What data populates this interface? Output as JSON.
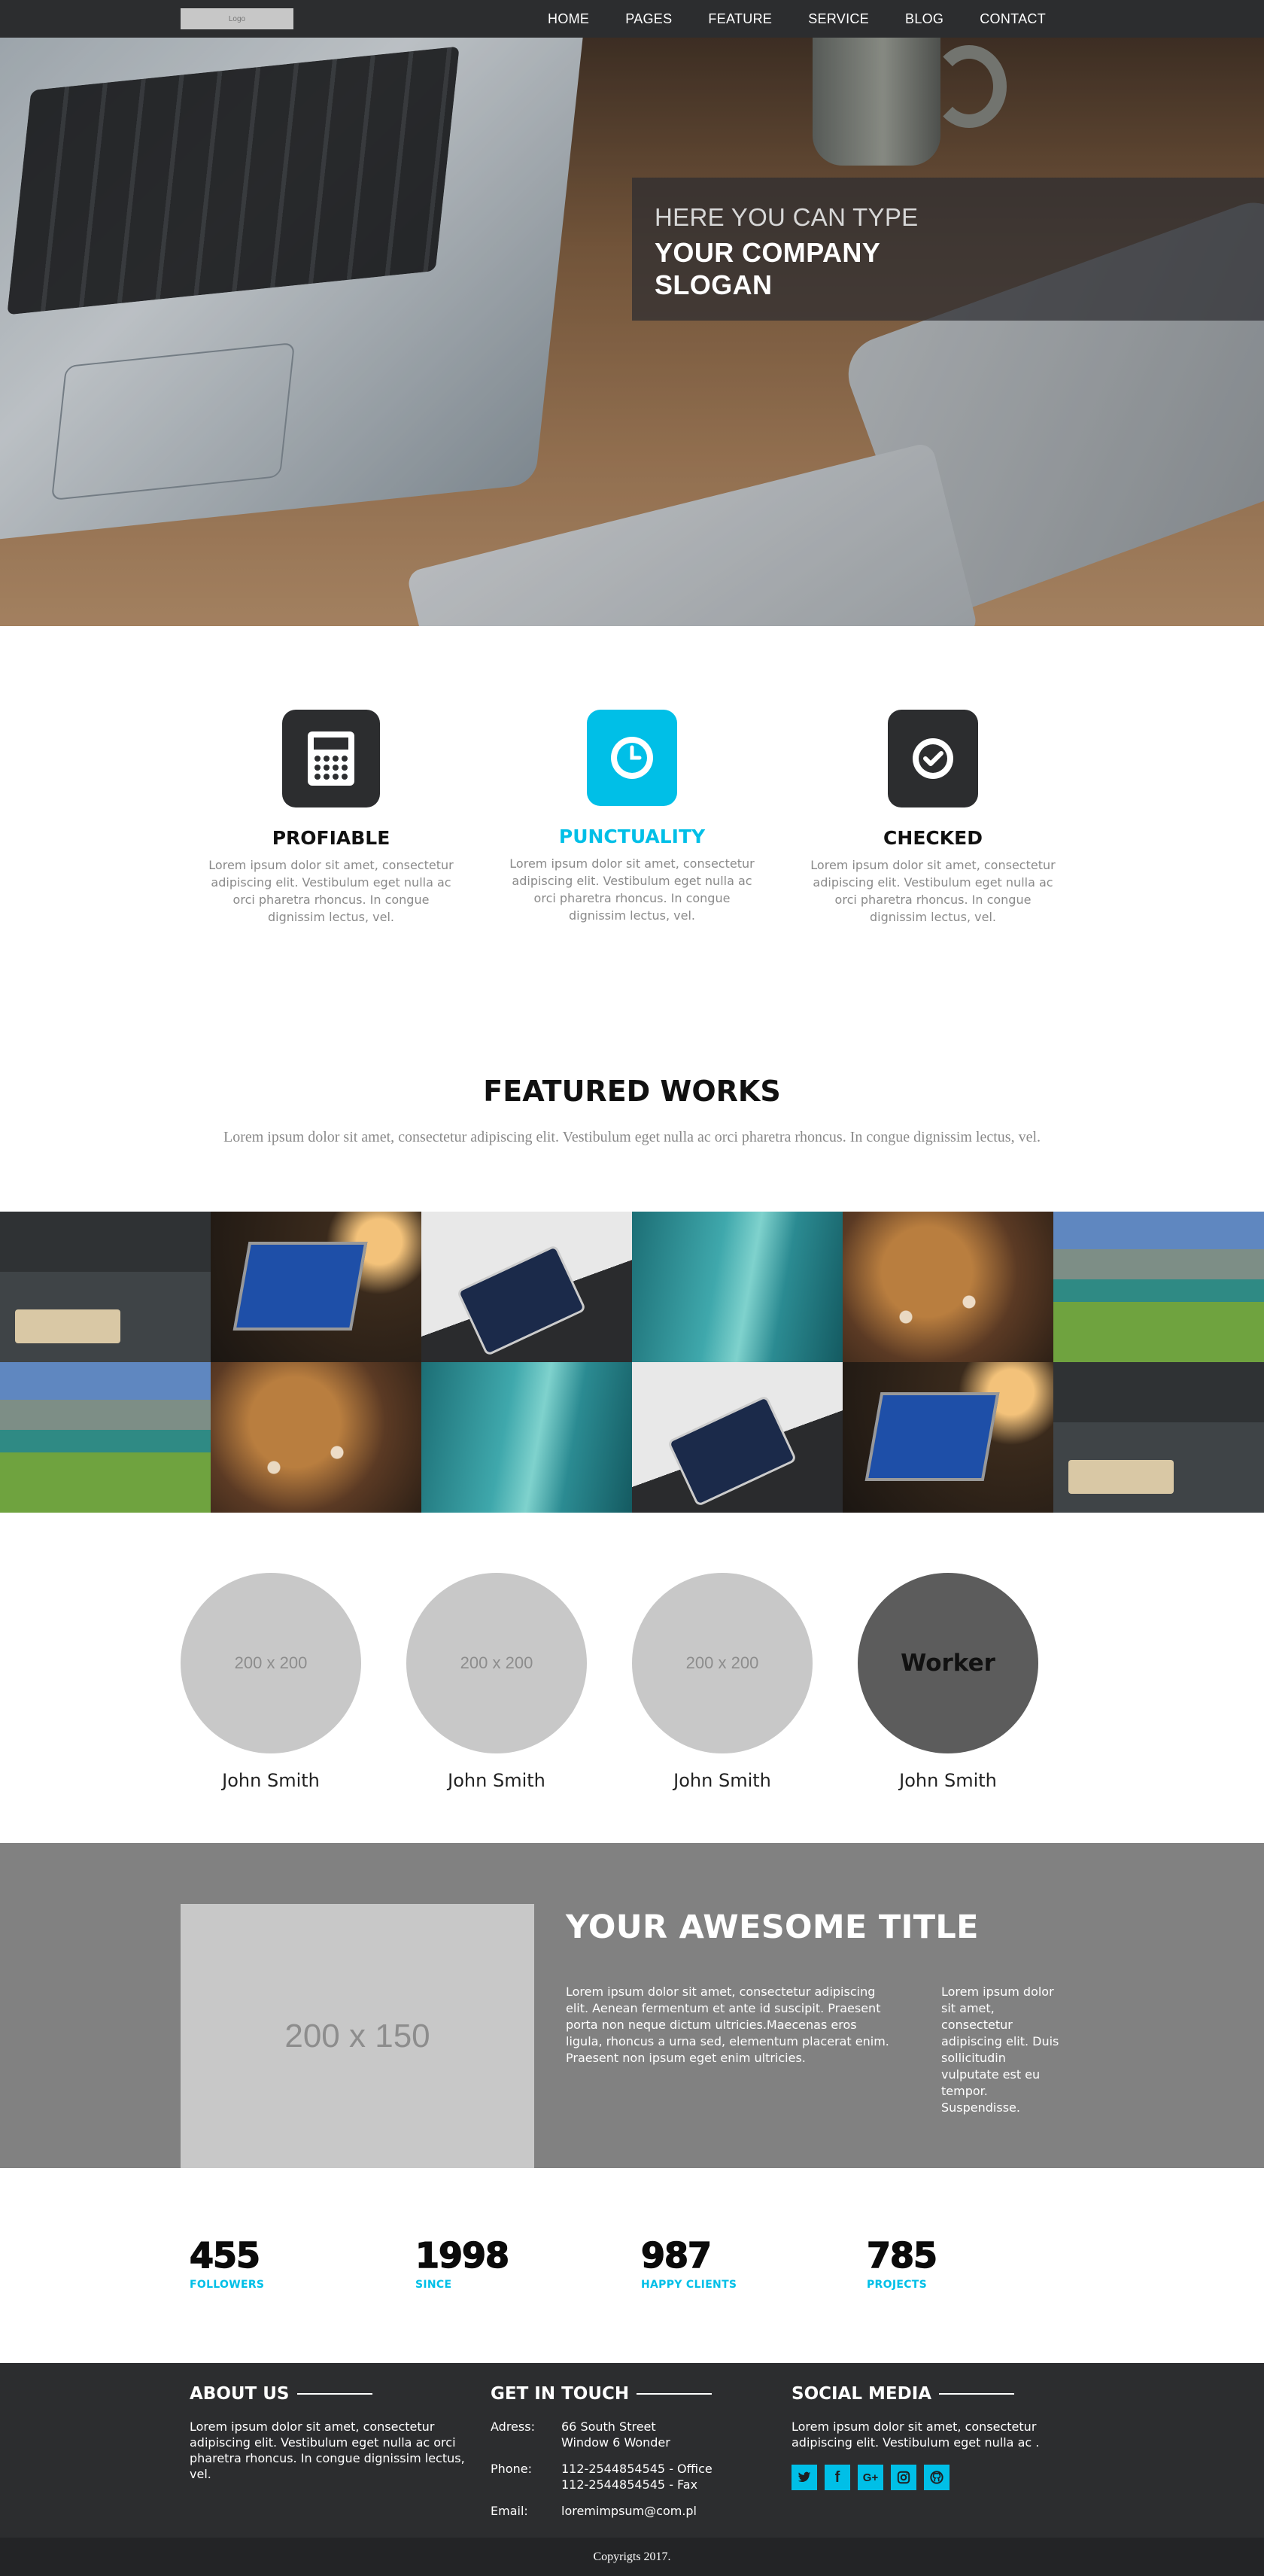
{
  "nav": {
    "logo_text": "Logo",
    "items": [
      {
        "label": "HOME"
      },
      {
        "label": "PAGES"
      },
      {
        "label": "FEATURE"
      },
      {
        "label": "SERVICE"
      },
      {
        "label": "BLOG"
      },
      {
        "label": "CONTACT"
      }
    ]
  },
  "hero": {
    "line1": "HERE YOU CAN TYPE",
    "line2": "YOUR COMPANY",
    "line3": "SLOGAN"
  },
  "features": [
    {
      "icon": "calculator-icon",
      "title": "PROFIABLE",
      "text": "Lorem ipsum dolor sit amet, consectetur adipiscing elit. Vestibulum eget nulla ac orci pharetra rhoncus. In congue dignissim lectus, vel."
    },
    {
      "icon": "clock-icon",
      "title": "PUNCTUALITY",
      "text": "Lorem ipsum dolor sit amet, consectetur adipiscing elit. Vestibulum eget nulla ac orci pharetra rhoncus. In congue dignissim lectus, vel."
    },
    {
      "icon": "check-circle-icon",
      "title": "CHECKED",
      "text": "Lorem ipsum dolor sit amet, consectetur adipiscing elit. Vestibulum eget nulla ac orci pharetra rhoncus. In congue dignissim lectus, vel."
    }
  ],
  "works": {
    "title": "FEATURED WORKS",
    "subtitle": "Lorem ipsum dolor sit amet, consectetur adipiscing elit. Vestibulum eget nulla ac orci pharetra rhoncus. In congue dignissim lectus, vel."
  },
  "team": [
    {
      "placeholder": "200 x 200",
      "name": "John Smith"
    },
    {
      "placeholder": "200 x 200",
      "name": "John Smith"
    },
    {
      "placeholder": "200 x 200",
      "name": "John Smith"
    },
    {
      "placeholder": "Worker",
      "name": "John Smith"
    }
  ],
  "about": {
    "image_placeholder": "200 x 150",
    "title": "YOUR AWESOME TITLE",
    "para1": "Lorem ipsum dolor sit amet, consectetur adipiscing elit. Aenean fermentum et ante id suscipit. Praesent porta non neque dictum ultricies.Maecenas eros ligula, rhoncus a urna sed, elementum placerat enim. Praesent non ipsum eget enim ultricies.",
    "para2": "Lorem ipsum dolor sit amet, consectetur adipiscing elit. Duis sollicitudin vulputate est eu tempor. Suspendisse."
  },
  "stats": [
    {
      "value": "455",
      "label": "FOLLOWERS"
    },
    {
      "value": "1998",
      "label": "SINCE"
    },
    {
      "value": "987",
      "label": "HAPPY CLIENTS"
    },
    {
      "value": "785",
      "label": "PROJECTS"
    }
  ],
  "footer": {
    "about_title": "ABOUT US",
    "about_text": "Lorem ipsum dolor sit amet, consectetur adipiscing elit. Vestibulum eget nulla ac orci pharetra rhoncus. In congue dignissim lectus, vel.",
    "contact_title": "GET IN TOUCH",
    "address_label": "Adress:",
    "address_line1": "66 South Street",
    "address_line2": "Window 6 Wonder",
    "phone_label": "Phone:",
    "phone_line1": "112-2544854545 - Office",
    "phone_line2": "112-2544854545 - Fax",
    "email_label": "Email:",
    "email": "loremimpsum@com.pl",
    "social_title": "SOCIAL MEDIA",
    "social_text": "Lorem ipsum dolor sit amet, consectetur adipiscing elit. Vestibulum eget nulla ac .",
    "social_icons": [
      "twitter-icon",
      "facebook-icon",
      "google-plus-icon",
      "instagram-icon",
      "github-icon"
    ],
    "copyright": "Copyrigts 2017."
  },
  "colors": {
    "accent": "#00bfe7",
    "dark": "#2c2d2f",
    "gray_band": "#818181"
  }
}
